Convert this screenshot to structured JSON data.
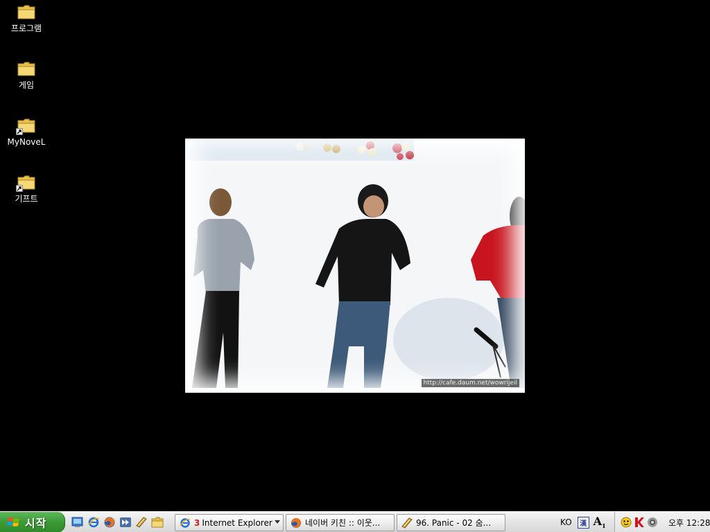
{
  "desktop": {
    "icons": [
      {
        "label": "프로그램",
        "shortcut": false
      },
      {
        "label": "게임",
        "shortcut": false
      },
      {
        "label": "MyNoveL",
        "shortcut": true
      },
      {
        "label": "기프트",
        "shortcut": true
      }
    ]
  },
  "wallpaper": {
    "watermark": "http://cafe.daum.net/wowrijeil"
  },
  "taskbar": {
    "start_label": "시작",
    "quick_launch": [
      "show-desktop-icon",
      "internet-explorer-icon",
      "firefox-icon",
      "media-player-icon",
      "winamp-icon",
      "folder-icon"
    ],
    "tasks": [
      {
        "count": "3",
        "label": "Internet Explorer",
        "icon": "internet-explorer-icon",
        "grouped": true
      },
      {
        "label": "네이버 키친 :: 이웃...",
        "icon": "firefox-icon"
      },
      {
        "label": "96. Panic - 02 숨...",
        "icon": "winamp-icon"
      }
    ],
    "language": {
      "code": "KO",
      "ime_label": "漢",
      "font_label": "A",
      "font_sub": "1"
    },
    "tray": {
      "icons": [
        "messenger-icon",
        "antivirus-k-icon",
        "volume-icon"
      ],
      "clock": "오후 12:28"
    }
  },
  "colors": {
    "desktop_background": "#000000",
    "start_button": "#3c9a36",
    "taskbar": "#e6e6e6"
  }
}
